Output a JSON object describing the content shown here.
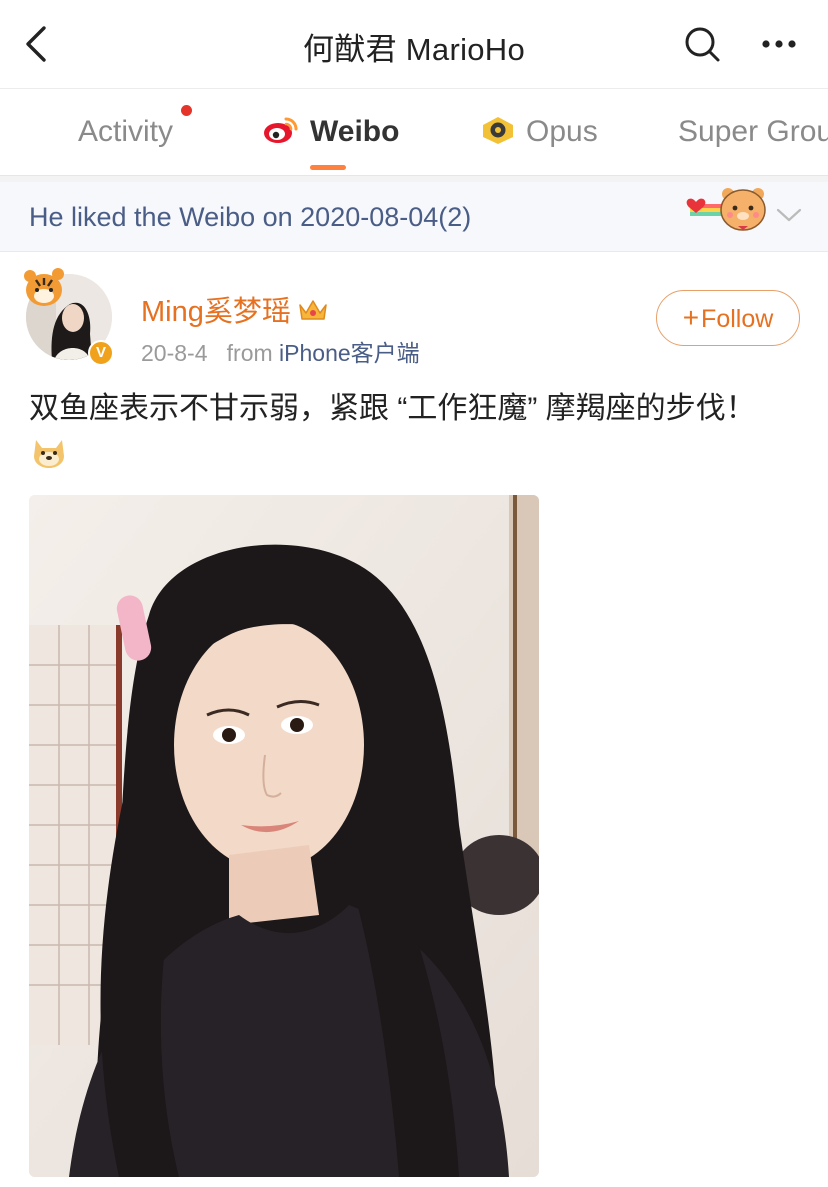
{
  "header": {
    "title": "何猷君 MarioHo",
    "back_icon": "chevron-left-icon",
    "search_icon": "search-icon",
    "more_icon": "more-dots-icon"
  },
  "tabs": [
    {
      "label": "Activity",
      "has_notification": true,
      "active": false
    },
    {
      "label": "Weibo",
      "icon": "weibo-logo-icon",
      "active": true
    },
    {
      "label": "Opus",
      "icon": "opus-icon",
      "active": false
    },
    {
      "label": "Super Grou",
      "active": false
    }
  ],
  "liked_banner": {
    "text": "He liked the Weibo on 2020-08-04(2)",
    "sticker_icon": "bear-sticker-icon",
    "chevron_icon": "chevron-down-icon"
  },
  "post": {
    "author": "Ming奚梦瑶",
    "author_badge_icon": "crown-icon",
    "verified_badge": "V",
    "date": "20-8-4",
    "from_label": "from",
    "source": "iPhone客户端",
    "follow_label": "Follow",
    "follow_plus": "+",
    "text": "双鱼座表示不甘示弱，紧跟 “工作狂魔” 摩羯座的步伐！",
    "emoji_icon": "doge-emoji-icon",
    "image_description_icon": "photo-image"
  },
  "colors": {
    "accent_orange": "#ff8140",
    "username_orange": "#e67121",
    "link_blue": "#4a5d86",
    "notification_red": "#e5352b"
  }
}
